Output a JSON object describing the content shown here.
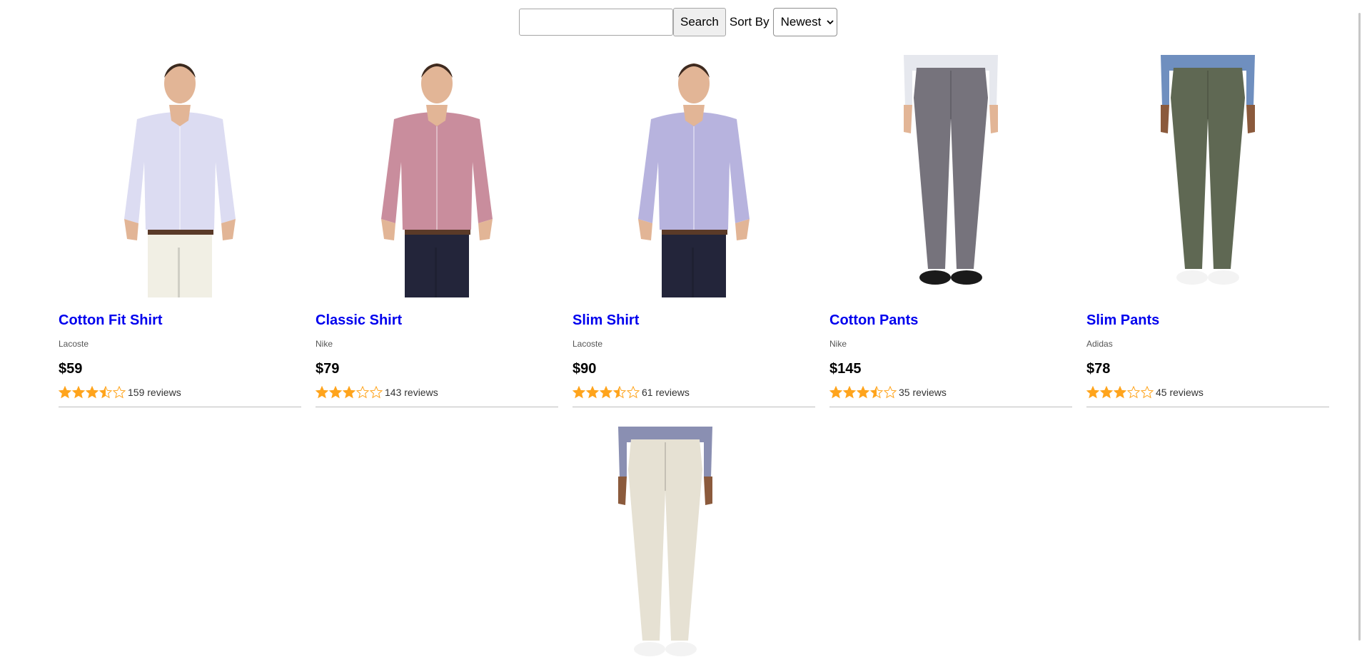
{
  "search": {
    "value": "",
    "placeholder": "",
    "button_label": "Search"
  },
  "sort": {
    "label": "Sort By",
    "selected": "Newest"
  },
  "colors": {
    "link": "#0000ee",
    "star": "#ffa41c"
  },
  "products": [
    {
      "name": "Cotton Fit Shirt",
      "brand": "Lacoste",
      "price": "$59",
      "rating": 3.5,
      "reviews": "159 reviews",
      "image": "man-shirt-icon"
    },
    {
      "name": "Classic Shirt",
      "brand": "Nike",
      "price": "$79",
      "rating": 3,
      "reviews": "143 reviews",
      "image": "man-shirt-icon"
    },
    {
      "name": "Slim Shirt",
      "brand": "Lacoste",
      "price": "$90",
      "rating": 3.5,
      "reviews": "61 reviews",
      "image": "man-shirt-icon"
    },
    {
      "name": "Cotton Pants",
      "brand": "Nike",
      "price": "$145",
      "rating": 3.5,
      "reviews": "35 reviews",
      "image": "pants-icon"
    },
    {
      "name": "Slim Pants",
      "brand": "Adidas",
      "price": "$78",
      "rating": 3,
      "reviews": "45 reviews",
      "image": "pants-icon"
    },
    {
      "name": "",
      "brand": "",
      "price": "",
      "rating": null,
      "reviews": "",
      "image": "pants-icon"
    }
  ]
}
